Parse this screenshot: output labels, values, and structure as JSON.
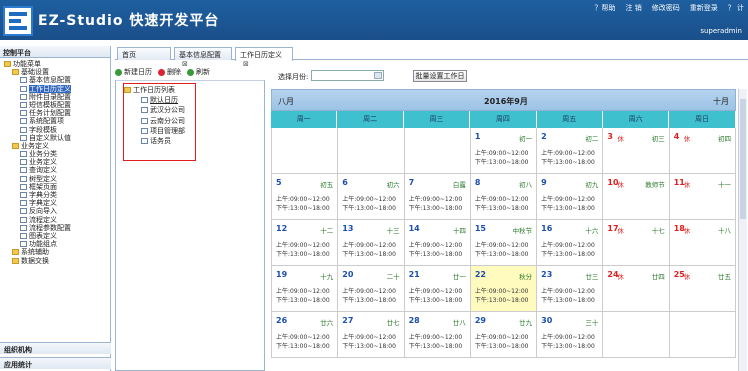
{
  "app": {
    "title": "EZ-Studio 快速开发平台",
    "user": "superadmin",
    "menu": [
      "？帮助",
      "注 销",
      "修改密码",
      "重新登录",
      "？ 计"
    ]
  },
  "left": {
    "panel_title": "控制平台",
    "tree": [
      {
        "label": "功能菜单",
        "lvl": 0,
        "type": "folder"
      },
      {
        "label": "基础设置",
        "lvl": 1,
        "type": "folder"
      },
      {
        "label": "基本信息配置",
        "lvl": 2,
        "type": "file"
      },
      {
        "label": "工作日历定义",
        "lvl": 2,
        "type": "file",
        "selected": true
      },
      {
        "label": "附件目录配置",
        "lvl": 2,
        "type": "file"
      },
      {
        "label": "短信模板配置",
        "lvl": 2,
        "type": "file"
      },
      {
        "label": "任务计划配置",
        "lvl": 2,
        "type": "file"
      },
      {
        "label": "系统配置项",
        "lvl": 2,
        "type": "file"
      },
      {
        "label": "字段模板",
        "lvl": 2,
        "type": "file"
      },
      {
        "label": "自定义默认值",
        "lvl": 2,
        "type": "file"
      },
      {
        "label": "业务定义",
        "lvl": 1,
        "type": "folder"
      },
      {
        "label": "业务分类",
        "lvl": 2,
        "type": "file"
      },
      {
        "label": "业务定义",
        "lvl": 2,
        "type": "file"
      },
      {
        "label": "查询定义",
        "lvl": 2,
        "type": "file"
      },
      {
        "label": "树型定义",
        "lvl": 2,
        "type": "file"
      },
      {
        "label": "框架页面",
        "lvl": 2,
        "type": "file"
      },
      {
        "label": "字典分类",
        "lvl": 2,
        "type": "file"
      },
      {
        "label": "字典定义",
        "lvl": 2,
        "type": "file"
      },
      {
        "label": "反向导入",
        "lvl": 2,
        "type": "file"
      },
      {
        "label": "流程定义",
        "lvl": 2,
        "type": "file"
      },
      {
        "label": "流程参数配置",
        "lvl": 2,
        "type": "file"
      },
      {
        "label": "图表定义",
        "lvl": 2,
        "type": "file"
      },
      {
        "label": "功能组点",
        "lvl": 2,
        "type": "file"
      },
      {
        "label": "系统辅助",
        "lvl": 1,
        "type": "folder"
      },
      {
        "label": "数据交换",
        "lvl": 1,
        "type": "folder"
      }
    ],
    "sections": [
      "组织机构",
      "应用统计"
    ]
  },
  "tabs": [
    {
      "label": "首页"
    },
    {
      "label": "基本信息配置"
    },
    {
      "label": "工作日历定义",
      "active": true
    }
  ],
  "toolbar": {
    "new": "新建日历",
    "del": "删除",
    "refresh": "刷新"
  },
  "worktree": {
    "root": "工作日历列表",
    "items": [
      "默认日历",
      "武汉分公司",
      "云南分公司",
      "项目管理部",
      "话务员"
    ]
  },
  "filter": {
    "label": "选择月份:",
    "batch": "批量设置工作日"
  },
  "calendar": {
    "prev": "八月",
    "title": "2016年9月",
    "next": "十月",
    "weekdays": [
      "周一",
      "周二",
      "周三",
      "周四",
      "周五",
      "周六",
      "周日"
    ],
    "weeks": [
      [
        null,
        null,
        null,
        {
          "d": "1",
          "l": "初一",
          "w": 1
        },
        {
          "d": "2",
          "l": "初二",
          "w": 1
        },
        {
          "d": "3",
          "l": "初三",
          "r": 1
        },
        {
          "d": "4",
          "l": "初四",
          "r": 1
        }
      ],
      [
        {
          "d": "5",
          "l": "初五",
          "w": 1
        },
        {
          "d": "6",
          "l": "初六",
          "w": 1
        },
        {
          "d": "7",
          "l": "白露",
          "w": 1
        },
        {
          "d": "8",
          "l": "初八",
          "w": 1
        },
        {
          "d": "9",
          "l": "初九",
          "w": 1
        },
        {
          "d": "10",
          "l": "教师节",
          "r": 1
        },
        {
          "d": "11",
          "l": "十一",
          "r": 1
        }
      ],
      [
        {
          "d": "12",
          "l": "十二",
          "w": 1
        },
        {
          "d": "13",
          "l": "十三",
          "w": 1
        },
        {
          "d": "14",
          "l": "十四",
          "w": 1
        },
        {
          "d": "15",
          "l": "中秋节",
          "w": 1
        },
        {
          "d": "16",
          "l": "十六",
          "w": 1
        },
        {
          "d": "17",
          "l": "十七",
          "r": 1
        },
        {
          "d": "18",
          "l": "十八",
          "r": 1
        }
      ],
      [
        {
          "d": "19",
          "l": "十九",
          "w": 1
        },
        {
          "d": "20",
          "l": "二十",
          "w": 1
        },
        {
          "d": "21",
          "l": "廿一",
          "w": 1
        },
        {
          "d": "22",
          "l": "秋分",
          "w": 1,
          "today": 1
        },
        {
          "d": "23",
          "l": "廿三",
          "w": 1
        },
        {
          "d": "24",
          "l": "廿四",
          "r": 1
        },
        {
          "d": "25",
          "l": "廿五",
          "r": 1
        }
      ],
      [
        {
          "d": "26",
          "l": "廿六",
          "w": 1
        },
        {
          "d": "27",
          "l": "廿七",
          "w": 1
        },
        {
          "d": "28",
          "l": "廿八",
          "w": 1
        },
        {
          "d": "29",
          "l": "廿九",
          "w": 1
        },
        {
          "d": "30",
          "l": "三十",
          "w": 1
        },
        null,
        null
      ]
    ],
    "am": "上午:09:00~12:00",
    "pm": "下午:13:00~18:00",
    "rest": "休"
  },
  "colors": {
    "header": "#1e5fa0",
    "weekday_bar": "#3fc0cf",
    "today": "#fffbbf",
    "rest": "#e02020",
    "lunar": "#2a7a2a"
  }
}
